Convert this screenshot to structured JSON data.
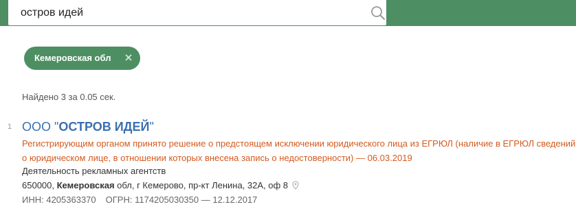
{
  "search": {
    "value": "остров идей"
  },
  "filter_chip": {
    "label": "Кемеровская обл",
    "close_glyph": "×"
  },
  "results_summary": "Найдено 3 за 0.05 сек.",
  "results": [
    {
      "number": "1",
      "title_prefix": "ООО \"",
      "title_name": "ОСТРОВ ИДЕЙ",
      "title_suffix": "\"",
      "warning": "Регистрирующим органом принято решение о предстоящем исключении юридического лица из ЕГРЮЛ (наличие в ЕГРЮЛ сведений о юридическом лице, в отношении которых внесена запись о недостоверности) — 06.03.2019",
      "activity": "Деятельность рекламных агентств",
      "address_start": "650000, ",
      "address_region": "Кемеровская",
      "address_rest": " обл, г Кемерово, пр-кт Ленина, 32А, оф 8",
      "inn": "ИНН: 4205363370",
      "ogrn": "ОГРН: 1174205030350 — 12.12.2017"
    }
  ],
  "colors": {
    "brand_green": "#4d8f62",
    "link_blue": "#3b6fb0",
    "warning_orange": "#d35a1e"
  },
  "icons": {
    "search": "search-icon",
    "close": "close-icon",
    "pin": "map-pin-icon"
  }
}
